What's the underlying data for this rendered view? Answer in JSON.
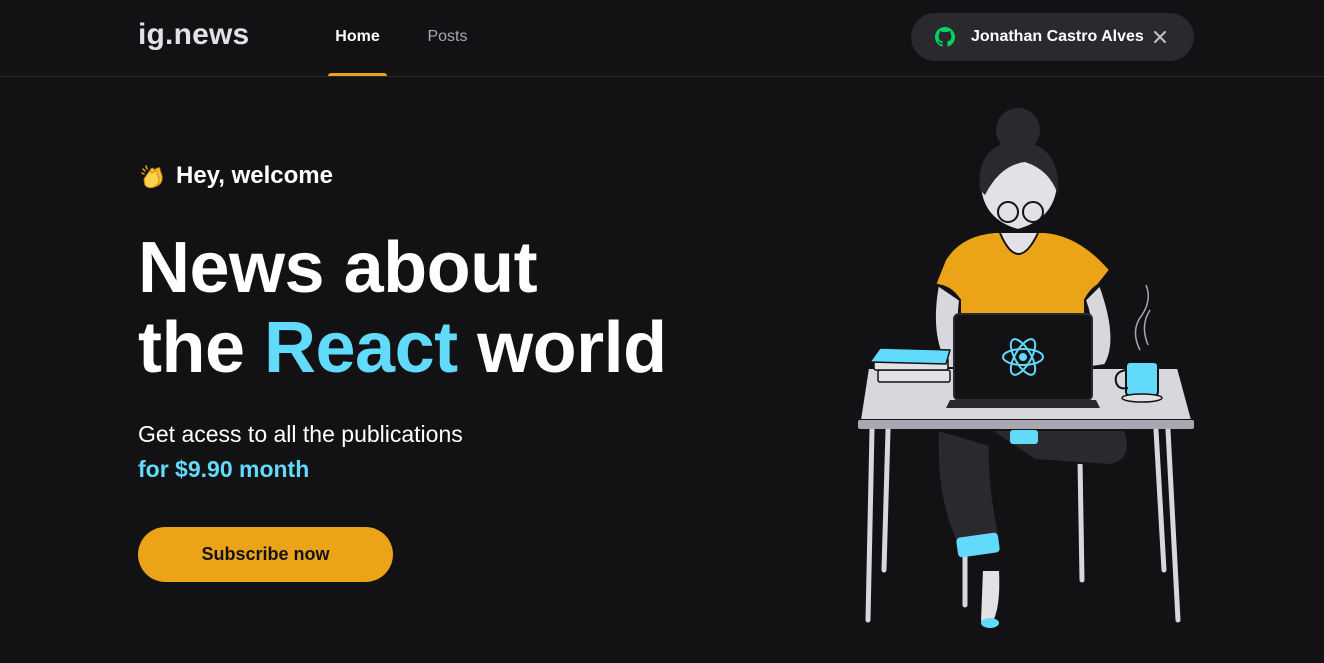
{
  "header": {
    "logo": "ig.news",
    "nav": [
      {
        "label": "Home",
        "active": true
      },
      {
        "label": "Posts",
        "active": false
      }
    ],
    "user": {
      "name": "Jonathan Castro Alves",
      "icon": "github-icon",
      "icon_color": "#04d361",
      "close_icon": "close-icon"
    }
  },
  "hero": {
    "welcome": "Hey, welcome",
    "welcome_icon": "clapping-hands-icon",
    "title_line1": "News about",
    "title_line2_start": "the ",
    "title_accent": "React",
    "title_line2_end": " world",
    "description": "Get acess to all the publications",
    "price": "for $9.90 month",
    "cta": "Subscribe now"
  },
  "colors": {
    "background": "#121214",
    "accent_yellow": "#eba417",
    "accent_cyan": "#61dafb",
    "surface": "#29292e"
  }
}
